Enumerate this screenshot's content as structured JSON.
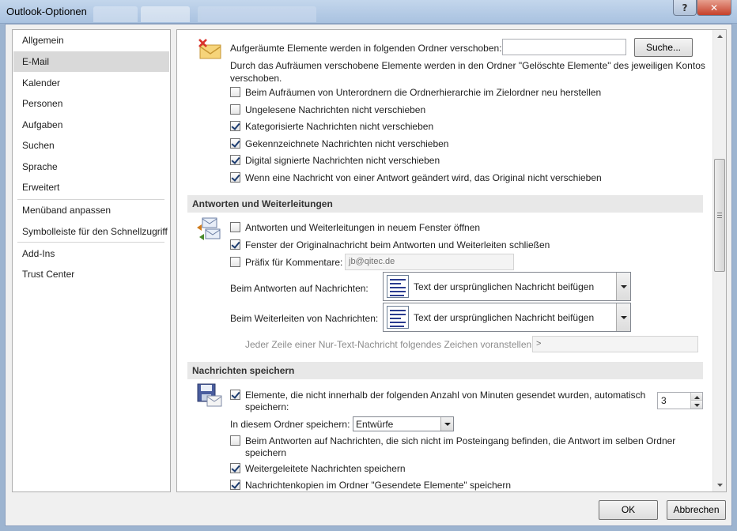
{
  "window": {
    "title": "Outlook-Optionen",
    "help_glyph": "?",
    "close_glyph": "✕"
  },
  "nav": {
    "items": [
      {
        "label": "Allgemein"
      },
      {
        "label": "E-Mail",
        "selected": true
      },
      {
        "label": "Kalender"
      },
      {
        "label": "Personen"
      },
      {
        "label": "Aufgaben"
      },
      {
        "label": "Suchen"
      },
      {
        "label": "Sprache"
      },
      {
        "label": "Erweitert"
      },
      {
        "label": "Menüband anpassen"
      },
      {
        "label": "Symbolleiste für den Schnellzugriff"
      },
      {
        "label": "Add-Ins"
      },
      {
        "label": "Trust Center"
      }
    ]
  },
  "cleanup": {
    "folder_label": "Aufgeräumte Elemente werden in folgenden Ordner verschoben:",
    "folder_value": "",
    "browse_button": "Suche...",
    "info_line1": "Durch das Aufräumen verschobene Elemente werden in den Ordner \"Gelöschte Elemente\" des jeweiligen Kontos",
    "info_line2": "verschoben.",
    "options": [
      {
        "label": "Beim Aufräumen von Unterordnern die Ordnerhierarchie im Zielordner neu herstellen",
        "checked": false
      },
      {
        "label": "Ungelesene Nachrichten nicht verschieben",
        "checked": false
      },
      {
        "label": "Kategorisierte Nachrichten nicht verschieben",
        "checked": true
      },
      {
        "label": "Gekennzeichnete Nachrichten nicht verschieben",
        "checked": true
      },
      {
        "label": "Digital signierte Nachrichten nicht verschieben",
        "checked": true
      },
      {
        "label": "Wenn eine Nachricht von einer Antwort geändert wird, das Original nicht verschieben",
        "checked": true
      }
    ]
  },
  "replies": {
    "header": "Antworten und Weiterleitungen",
    "open_new_window": {
      "label": "Antworten und Weiterleitungen in neuem Fenster öffnen",
      "checked": false
    },
    "close_original": {
      "label": "Fenster der Originalnachricht beim Antworten und Weiterleiten schließen",
      "checked": true
    },
    "prefix_comments": {
      "label": "Präfix für Kommentare:",
      "checked": false,
      "value": "jb@qitec.de"
    },
    "reply_label": "Beim Antworten auf Nachrichten:",
    "reply_value": "Text der ursprünglichen Nachricht beifügen",
    "forward_label": "Beim Weiterleiten von Nachrichten:",
    "forward_value": "Text der ursprünglichen Nachricht beifügen",
    "plaintext_prefix_label": "Jeder Zeile einer Nur-Text-Nachricht folgendes Zeichen voranstellen:",
    "plaintext_prefix_value": ">"
  },
  "save": {
    "header": "Nachrichten speichern",
    "autosave": {
      "line1": "Elemente, die nicht innerhalb der folgenden Anzahl von Minuten gesendet wurden, automatisch",
      "line2": "speichern:",
      "checked": true,
      "minutes": "3"
    },
    "folder_label": "In diesem Ordner speichern:",
    "folder_value": "Entwürfe",
    "reply_same_folder": {
      "line1": "Beim Antworten auf Nachrichten, die sich nicht im Posteingang befinden, die Antwort im selben Ordner",
      "line2": "speichern",
      "checked": false
    },
    "save_forwarded": {
      "label": "Weitergeleitete Nachrichten speichern",
      "checked": true
    },
    "save_copies": {
      "label": "Nachrichtenkopien im Ordner \"Gesendete Elemente\" speichern",
      "checked": true
    }
  },
  "footer": {
    "ok": "OK",
    "cancel": "Abbrechen"
  }
}
